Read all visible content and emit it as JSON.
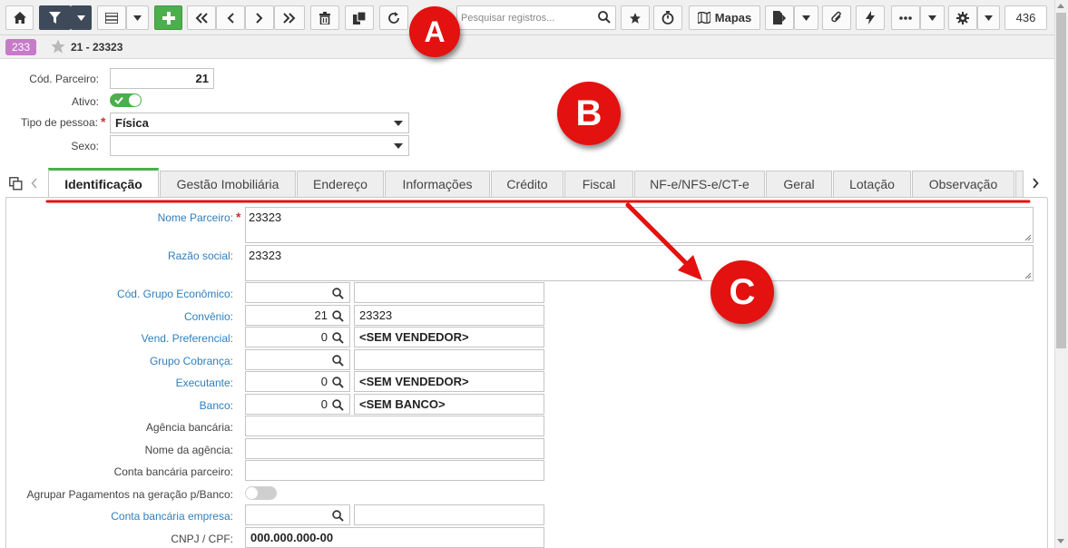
{
  "toolbar": {
    "map_label": "Mapas",
    "search_placeholder": "Pesquisar registros...",
    "record_counter": "436",
    "icons": [
      "home-icon",
      "filter-icon",
      "grid-icon",
      "add-icon",
      "first-icon",
      "prev-icon",
      "next-icon",
      "last-icon",
      "delete-icon",
      "copy-icon",
      "refresh-icon",
      "favorite-icon",
      "timer-icon",
      "map-icon",
      "export-icon",
      "attach-icon",
      "lightning-icon",
      "more-icon",
      "gear-icon"
    ]
  },
  "record": {
    "badge": "233",
    "title": "21 - 23323"
  },
  "header_form": {
    "cod_parceiro_label": "Cód. Parceiro:",
    "cod_parceiro_value": "21",
    "ativo_label": "Ativo:",
    "ativo_on": true,
    "tipo_pessoa_label": "Tipo de pessoa:",
    "tipo_pessoa_value": "Física",
    "sexo_label": "Sexo:",
    "sexo_value": ""
  },
  "tabs": [
    {
      "label": "Identificação",
      "active": true
    },
    {
      "label": "Gestão Imobiliária"
    },
    {
      "label": "Endereço"
    },
    {
      "label": "Informações"
    },
    {
      "label": "Crédito"
    },
    {
      "label": "Fiscal"
    },
    {
      "label": "NF-e/NFS-e/CT-e"
    },
    {
      "label": "Geral"
    },
    {
      "label": "Lotação"
    },
    {
      "label": "Observação"
    }
  ],
  "identificacao": {
    "nome_parceiro_label": "Nome Parceiro:",
    "nome_parceiro_value": "23323",
    "razao_social_label": "Razão social:",
    "razao_social_value": "23323",
    "grupo_economico_label": "Cód. Grupo Econômico:",
    "grupo_economico_code": "",
    "grupo_economico_desc": "",
    "convenio_label": "Convênio:",
    "convenio_code": "21",
    "convenio_desc": "23323",
    "vendedor_label": "Vend. Preferencial:",
    "vendedor_code": "0",
    "vendedor_desc": "<SEM VENDEDOR>",
    "grupo_cobranca_label": "Grupo Cobrança:",
    "grupo_cobranca_code": "",
    "grupo_cobranca_desc": "",
    "executante_label": "Executante:",
    "executante_code": "0",
    "executante_desc": "<SEM VENDEDOR>",
    "banco_label": "Banco:",
    "banco_code": "0",
    "banco_desc": "<SEM BANCO>",
    "agencia_label": "Agência bancária:",
    "agencia_value": "",
    "nome_agencia_label": "Nome da agência:",
    "nome_agencia_value": "",
    "conta_parceiro_label": "Conta bancária parceiro:",
    "conta_parceiro_value": "",
    "agrupar_label": "Agrupar Pagamentos na geração p/Banco:",
    "agrupar_on": false,
    "conta_empresa_label": "Conta bancária empresa:",
    "conta_empresa_code": "",
    "conta_empresa_desc": "",
    "cnpj_label": "CNPJ / CPF:",
    "cnpj_value": "000.000.000-00"
  },
  "annotations": {
    "a": "A",
    "b": "B",
    "c": "C"
  },
  "colors": {
    "accent_green": "#4cae4c",
    "link_blue": "#2f7fbf",
    "callout_red": "#e3110f",
    "badge_purple": "#c67bc9",
    "required_red": "#d0312d"
  }
}
